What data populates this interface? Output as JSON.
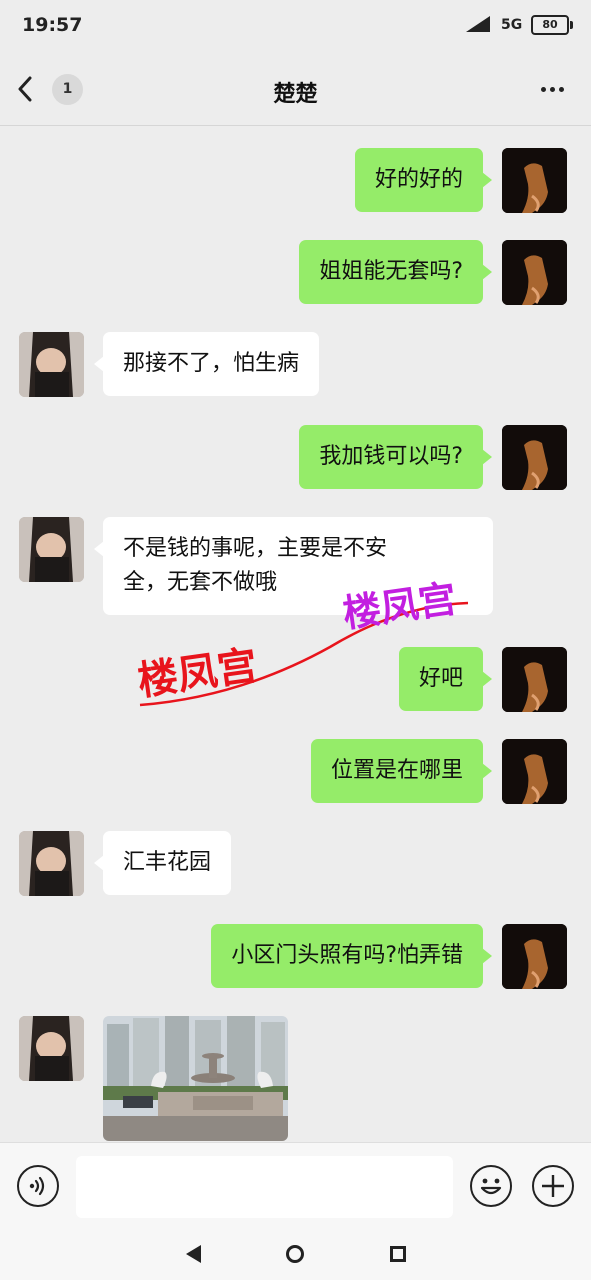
{
  "status": {
    "time": "19:57",
    "network": "5G",
    "battery": "80"
  },
  "header": {
    "back_icon": "chevron-left-icon",
    "unread_count": "1",
    "title": "楚楚",
    "more_icon": "more-dots-icon"
  },
  "messages": [
    {
      "from": "me",
      "text": "好的好的"
    },
    {
      "from": "me",
      "text": "姐姐能无套吗?"
    },
    {
      "from": "contact",
      "text": "那接不了，怕生病"
    },
    {
      "from": "me",
      "text": "我加钱可以吗?"
    },
    {
      "from": "contact",
      "text_line1": "不是钱的事呢，主要是不安",
      "text_line2": "全，无套不做哦"
    },
    {
      "from": "me",
      "text": "好吧"
    },
    {
      "from": "me",
      "text": "位置是在哪里"
    },
    {
      "from": "contact",
      "text": "汇丰花园"
    },
    {
      "from": "me",
      "text": "小区门头照有吗?怕弄错"
    },
    {
      "from": "contact",
      "type": "image"
    }
  ],
  "watermark": {
    "text": "楼凤宫",
    "colors": {
      "red": "#e8141c",
      "purple": "#c21fe0"
    }
  },
  "input_bar": {
    "voice_icon": "voice-icon",
    "emoji_icon": "emoji-icon",
    "plus_icon": "plus-icon",
    "value": ""
  },
  "colors": {
    "sent_bubble": "#95ec69",
    "received_bubble": "#ffffff",
    "background": "#ededed"
  }
}
